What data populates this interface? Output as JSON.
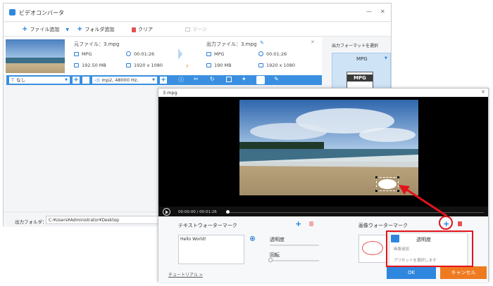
{
  "app": {
    "title": "ビデオコンバータ",
    "window_controls": {
      "minimize": "—",
      "close": "✕"
    }
  },
  "toolbar": {
    "add_file": "ファイル追加",
    "add_folder": "フォルダ追加",
    "clear": "クリア",
    "merge": "マージ"
  },
  "file": {
    "source_label": "元ファイル：3.mpg",
    "output_label": "出力ファイル：3.mpg",
    "src_format": "MPG",
    "src_duration": "00:01:26",
    "src_size": "192.50 MB",
    "src_resolution": "1920 x 1080",
    "out_format": "MPG",
    "out_duration": "00:01:26",
    "out_size": "190 MB",
    "out_resolution": "1920 x 1080"
  },
  "opsbar": {
    "subtitle_select": "なし",
    "audio_select": "mp2, 48000 Hz,"
  },
  "output_format": {
    "label": "出力フォーマットを選択",
    "selected": "MPG",
    "badge": "MPG"
  },
  "bottom": {
    "output_folder_label": "出力フォルダ：",
    "output_folder_path": "C:¥Users¥Administrator¥Desktop"
  },
  "dialog": {
    "title": "3.mpg",
    "close": "✕",
    "time_current": "00:00:00",
    "time_separator": "/",
    "time_total": "00:01:26",
    "text_wm_label": "テキストウォーターマーク",
    "text_wm_value": "Hello World!",
    "opacity_label": "透明度",
    "rotation_label": "回転",
    "image_wm_label": "画像ウォーターマーク",
    "image_opacity_label": "透明度",
    "menu_add_image": "画像追加",
    "menu_select_preset": "プリセットを選択します",
    "tutorial_link": "チュートリアル >",
    "ok": "OK",
    "cancel": "キャンセル"
  },
  "colors": {
    "accent": "#2f86de",
    "cancel": "#f07a1f",
    "highlight": "#e2141c"
  }
}
